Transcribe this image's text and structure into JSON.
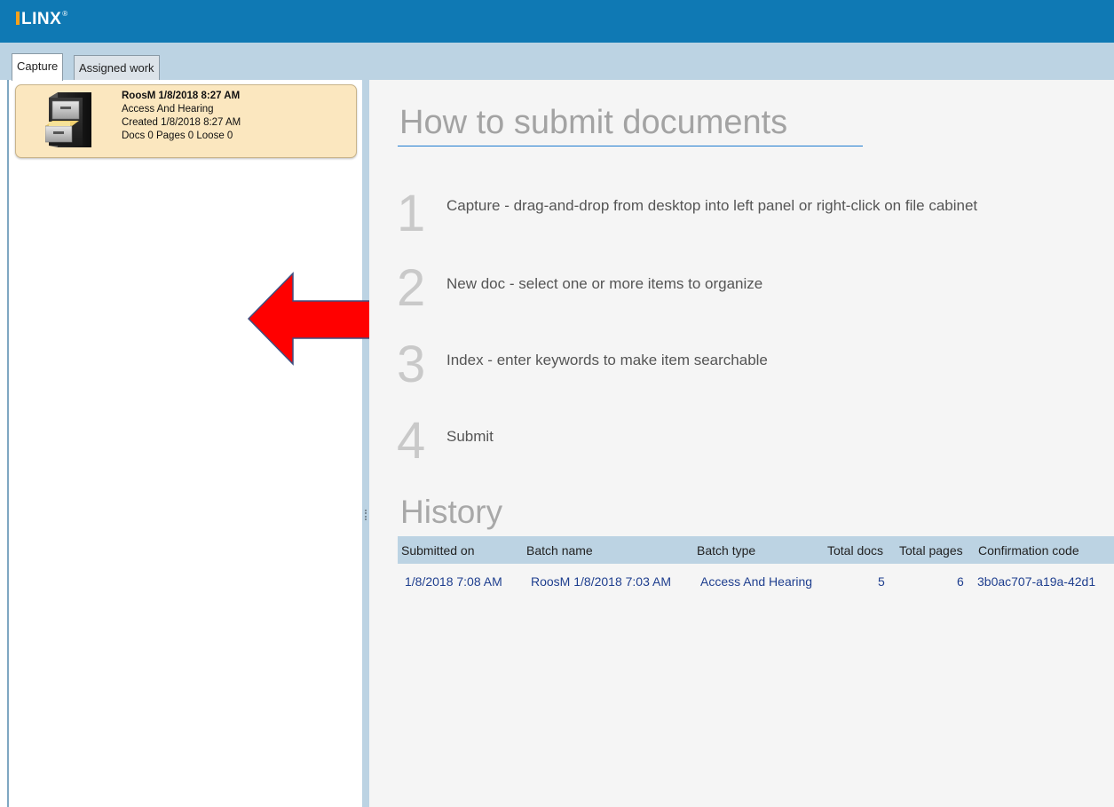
{
  "app": {
    "logo_text": "LINX",
    "logo_reg": "®",
    "brand_color": "#0f79b4",
    "accent_color": "#f7a11a"
  },
  "tabs": [
    {
      "label": "Capture",
      "active": true
    },
    {
      "label": "Assigned work",
      "active": false
    }
  ],
  "batch": {
    "icon": "file-cabinet-icon",
    "name": "RoosM 1/8/2018 8:27 AM",
    "type": "Access And Hearing",
    "created": "Created 1/8/2018 8:27 AM",
    "counts": "Docs 0  Pages 0  Loose 0"
  },
  "arrow": {
    "icon": "red-left-arrow-icon",
    "color": "#ff0000"
  },
  "instructions": {
    "title": "How to submit documents",
    "steps": [
      {
        "number": "1",
        "text": "Capture - drag-and-drop from desktop into left panel or right-click on file cabinet"
      },
      {
        "number": "2",
        "text": "New doc - select one or more items to organize"
      },
      {
        "number": "3",
        "text": "Index - enter keywords to make item searchable"
      },
      {
        "number": "4",
        "text": "Submit"
      }
    ]
  },
  "history": {
    "title": "History",
    "columns": [
      "Submitted on",
      "Batch name",
      "Batch type",
      "Total docs",
      "Total pages",
      "Confirmation code"
    ],
    "rows": [
      [
        "1/8/2018 7:08 AM",
        "RoosM 1/8/2018 7:03 AM",
        "Access And Hearing",
        "5",
        "6",
        "3b0ac707-a19a-42d1"
      ]
    ]
  }
}
